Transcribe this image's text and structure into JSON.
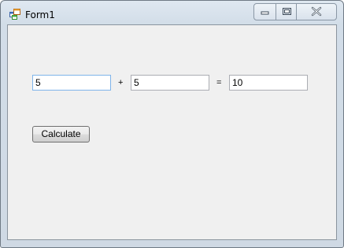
{
  "window": {
    "title": "Form1",
    "icon": "winforms-app-icon",
    "caption_buttons": [
      "minimize-icon",
      "maximize-icon",
      "close-icon"
    ]
  },
  "form": {
    "operand1_value": "5",
    "plus_label": "+",
    "operand2_value": "5",
    "equals_label": "=",
    "result_value": "10",
    "calculate_label": "Calculate"
  },
  "colors": {
    "client_background": "#f0f0f0",
    "focus_border": "#7eb4ea"
  }
}
